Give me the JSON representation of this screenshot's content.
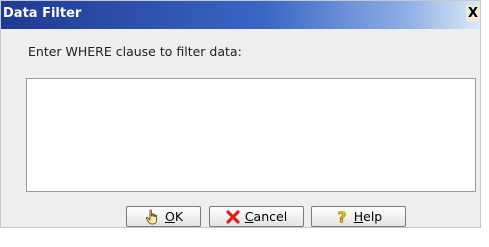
{
  "dialog": {
    "title": "Data Filter",
    "close_glyph": "X",
    "prompt": "Enter WHERE clause to filter data:",
    "where_clause": {
      "value": "",
      "placeholder": ""
    }
  },
  "buttons": {
    "ok": {
      "label": "OK",
      "mnemonic": "O",
      "rest": "K",
      "icon": "hand-pointer-icon"
    },
    "cancel": {
      "label": "Cancel",
      "mnemonic": "C",
      "rest": "ancel",
      "icon": "red-x-icon"
    },
    "help": {
      "label": "Help",
      "mnemonic": "H",
      "rest": "elp",
      "icon": "question-mark-icon"
    }
  },
  "colors": {
    "title_bar_start": "#1f3a93",
    "title_bar_end": "#dde8f8",
    "dialog_bg": "#eeeeee",
    "cancel_icon": "#e02020",
    "help_icon": "#f2c200"
  }
}
